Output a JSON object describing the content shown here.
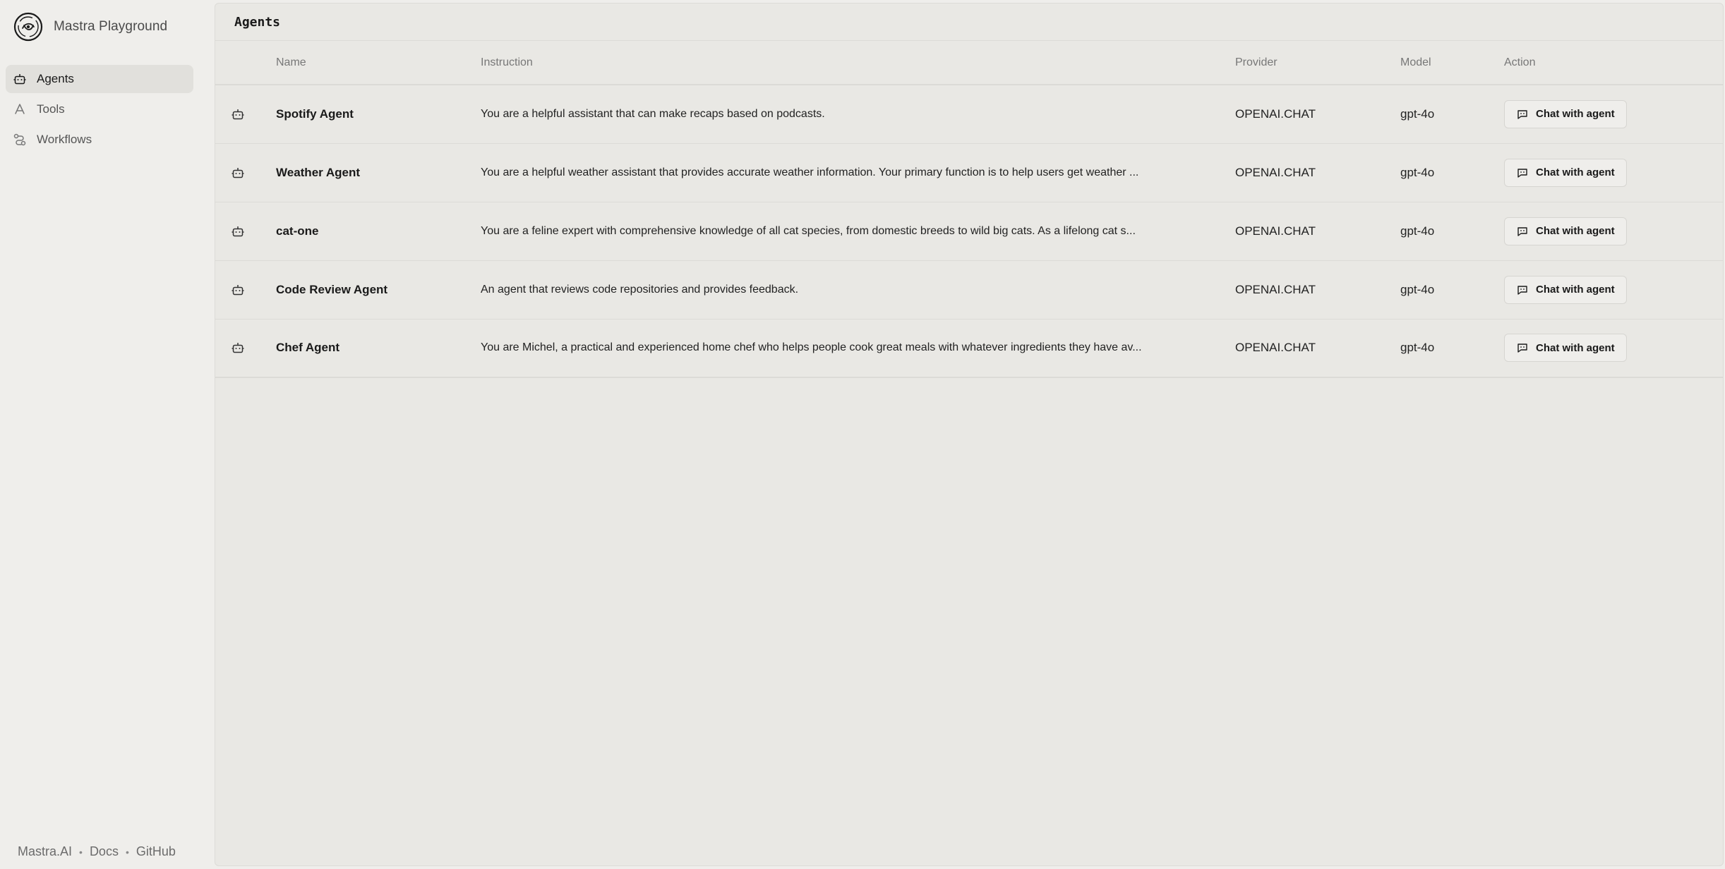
{
  "app": {
    "title": "Mastra Playground"
  },
  "sidebar": {
    "items": [
      {
        "label": "Agents",
        "icon": "bot-icon",
        "active": true
      },
      {
        "label": "Tools",
        "icon": "tools-icon",
        "active": false
      },
      {
        "label": "Workflows",
        "icon": "workflow-icon",
        "active": false
      }
    ],
    "footer": {
      "links": [
        "Mastra.AI",
        "Docs",
        "GitHub"
      ],
      "separator": "•"
    }
  },
  "main": {
    "title": "Agents",
    "columns": [
      "Name",
      "Instruction",
      "Provider",
      "Model",
      "Action"
    ],
    "rows": [
      {
        "name": "Spotify Agent",
        "instruction": "You are a helpful assistant that can make recaps based on podcasts.",
        "provider": "OPENAI.CHAT",
        "model": "gpt-4o",
        "action": "Chat with agent"
      },
      {
        "name": "Weather Agent",
        "instruction": "You are a helpful weather assistant that provides accurate weather information. Your primary function is to help users get weather ...",
        "provider": "OPENAI.CHAT",
        "model": "gpt-4o",
        "action": "Chat with agent"
      },
      {
        "name": "cat-one",
        "instruction": "You are a feline expert with comprehensive knowledge of all cat species, from domestic breeds to wild big cats. As a lifelong cat s...",
        "provider": "OPENAI.CHAT",
        "model": "gpt-4o",
        "action": "Chat with agent"
      },
      {
        "name": "Code Review Agent",
        "instruction": "An agent that reviews code repositories and provides feedback.",
        "provider": "OPENAI.CHAT",
        "model": "gpt-4o",
        "action": "Chat with agent"
      },
      {
        "name": "Chef Agent",
        "instruction": "You are Michel, a practical and experienced home chef who helps people cook great meals with whatever ingredients they have av...",
        "provider": "OPENAI.CHAT",
        "model": "gpt-4o",
        "action": "Chat with agent"
      }
    ]
  }
}
